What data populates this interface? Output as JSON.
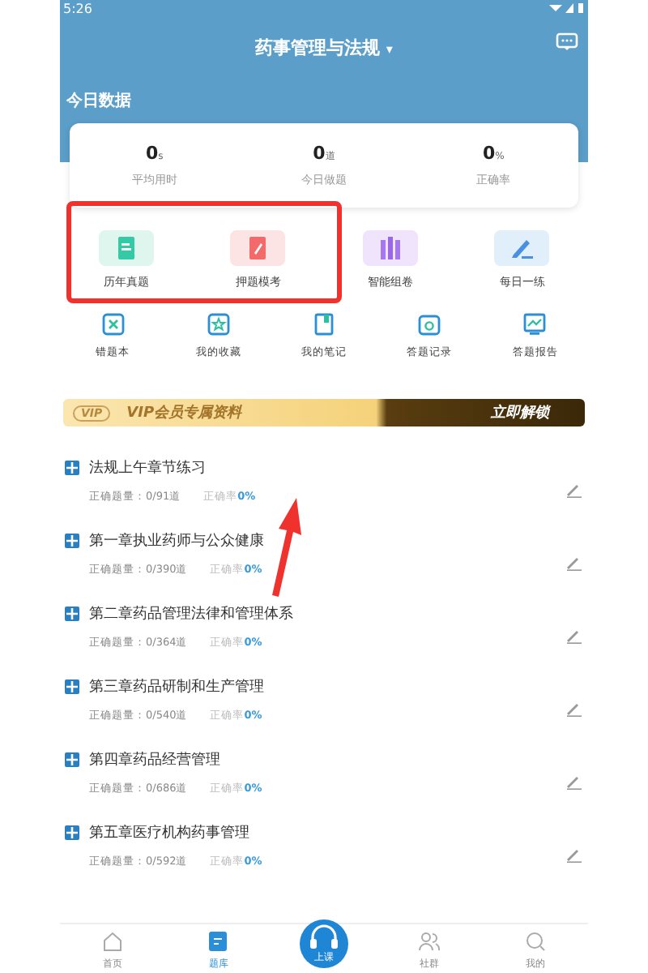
{
  "status_bar": {
    "time": "5:26"
  },
  "header": {
    "title": "药事管理与法规",
    "dropdown": "▾"
  },
  "today": {
    "title": "今日数据",
    "stats": [
      {
        "value": "0",
        "unit": "s",
        "label": "平均用时"
      },
      {
        "value": "0",
        "unit": "道",
        "label": "今日做题"
      },
      {
        "value": "0",
        "unit": "%",
        "label": "正确率"
      }
    ]
  },
  "features": [
    {
      "label": "历年真题"
    },
    {
      "label": "押题模考"
    },
    {
      "label": "智能组卷"
    },
    {
      "label": "每日一练"
    }
  ],
  "tools": [
    {
      "label": "错题本"
    },
    {
      "label": "我的收藏"
    },
    {
      "label": "我的笔记"
    },
    {
      "label": "答题记录"
    },
    {
      "label": "答题报告"
    }
  ],
  "banner": {
    "text": "VIP会员专属资料",
    "badge": "VIP",
    "action": "立即解锁"
  },
  "chapters": [
    {
      "title": "法规上午章节练习",
      "count_label": "正确题量：0/91道",
      "rate_label": "正确率",
      "rate": "0%"
    },
    {
      "title": "第一章执业药师与公众健康",
      "count_label": "正确题量：0/390道",
      "rate_label": "正确率",
      "rate": "0%"
    },
    {
      "title": "第二章药品管理法律和管理体系",
      "count_label": "正确题量：0/364道",
      "rate_label": "正确率",
      "rate": "0%"
    },
    {
      "title": "第三章药品研制和生产管理",
      "count_label": "正确题量：0/540道",
      "rate_label": "正确率",
      "rate": "0%"
    },
    {
      "title": "第四章药品经营管理",
      "count_label": "正确题量：0/686道",
      "rate_label": "正确率",
      "rate": "0%"
    },
    {
      "title": "第五章医疗机构药事管理",
      "count_label": "正确题量：0/592道",
      "rate_label": "正确率",
      "rate": "0%"
    }
  ],
  "nav": [
    {
      "label": "首页",
      "kind": "home",
      "selected": false
    },
    {
      "label": "题库",
      "kind": "bank",
      "selected": true
    },
    {
      "label": "上课",
      "kind": "class",
      "selected": false
    },
    {
      "label": "社群",
      "kind": "group",
      "selected": false
    },
    {
      "label": "我的",
      "kind": "me",
      "selected": false
    }
  ]
}
